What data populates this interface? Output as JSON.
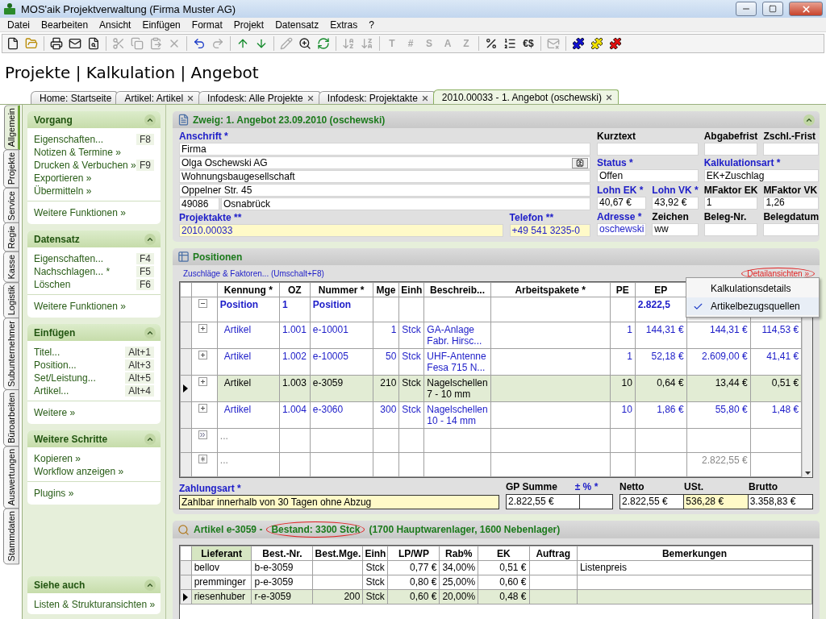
{
  "window": {
    "title": "MOS'aik Projektverwaltung (Firma Muster AG)"
  },
  "menu": [
    "Datei",
    "Bearbeiten",
    "Ansicht",
    "Einfügen",
    "Format",
    "Projekt",
    "Datensatz",
    "Extras",
    "?"
  ],
  "toolbar": [
    {
      "kind": "icon",
      "disabled": false
    },
    {
      "kind": "icon",
      "disabled": false
    },
    {
      "kind": "separator"
    },
    {
      "kind": "icon",
      "disabled": false
    },
    {
      "kind": "icon",
      "disabled": false
    },
    {
      "kind": "icon",
      "disabled": false
    },
    {
      "kind": "separator"
    },
    {
      "kind": "icon",
      "disabled": true
    },
    {
      "kind": "icon",
      "disabled": true
    },
    {
      "kind": "icon",
      "disabled": true
    },
    {
      "kind": "icon",
      "disabled": true
    },
    {
      "kind": "separator"
    },
    {
      "kind": "icon",
      "disabled": false
    },
    {
      "kind": "icon",
      "disabled": true
    },
    {
      "kind": "separator"
    },
    {
      "kind": "icon",
      "disabled": false
    },
    {
      "kind": "icon",
      "disabled": false
    },
    {
      "kind": "separator"
    },
    {
      "kind": "icon",
      "disabled": true
    },
    {
      "kind": "icon",
      "disabled": false
    },
    {
      "kind": "icon",
      "disabled": false
    },
    {
      "kind": "separator"
    },
    {
      "kind": "icon",
      "disabled": true
    },
    {
      "kind": "icon",
      "disabled": true
    },
    {
      "kind": "separator"
    },
    {
      "kind": "glyph",
      "text": "T",
      "disabled": true
    },
    {
      "kind": "glyph",
      "text": "#",
      "disabled": true
    },
    {
      "kind": "glyph",
      "text": "S",
      "disabled": true
    },
    {
      "kind": "glyph",
      "text": "A",
      "disabled": true
    },
    {
      "kind": "glyph",
      "text": "Z",
      "disabled": true
    },
    {
      "kind": "separator"
    },
    {
      "kind": "icon",
      "disabled": false
    },
    {
      "kind": "icon",
      "disabled": false
    },
    {
      "kind": "glyph",
      "text": "€$",
      "disabled": false
    },
    {
      "kind": "separator"
    },
    {
      "kind": "icon",
      "disabled": true
    },
    {
      "kind": "separator"
    },
    {
      "kind": "icon",
      "disabled": false
    },
    {
      "kind": "icon",
      "disabled": false
    },
    {
      "kind": "icon",
      "disabled": false
    }
  ],
  "heading": "Projekte | Kalkulation | Angebot",
  "tabs": [
    {
      "label": "Home: Startseite",
      "selected": false,
      "closable": false
    },
    {
      "label": "Artikel: Artikel",
      "selected": false,
      "closable": true
    },
    {
      "label": "Infodesk: Alle Projekte",
      "selected": false,
      "closable": true
    },
    {
      "label": "Infodesk: Projektakte",
      "selected": false,
      "closable": true
    },
    {
      "label": "2010.00033 - 1. Angebot (oschewski)",
      "selected": true,
      "closable": true
    }
  ],
  "side_tabs": [
    {
      "label": "Allgemein",
      "selected": true
    },
    {
      "label": "Projekte",
      "selected": false
    },
    {
      "label": "Service",
      "selected": false
    },
    {
      "label": "Regie",
      "selected": false
    },
    {
      "label": "Kasse",
      "selected": false
    },
    {
      "label": "Logistik",
      "selected": false
    },
    {
      "label": "Subunternehmer",
      "selected": false
    },
    {
      "label": "Büroarbeiten",
      "selected": false
    },
    {
      "label": "Auswertungen",
      "selected": false
    },
    {
      "label": "Stammdaten",
      "selected": false
    }
  ],
  "sidebar": {
    "panels": [
      {
        "title": "Vorgang",
        "items": [
          {
            "label": "Eigenschaften...",
            "shortcut": "F8"
          },
          {
            "label": "Notizen & Termine »"
          },
          {
            "label": "Drucken & Verbuchen »",
            "shortcut": "F9"
          },
          {
            "label": "Exportieren »"
          },
          {
            "label": "Übermitteln »"
          }
        ],
        "more": [
          "Weitere Funktionen »"
        ]
      },
      {
        "title": "Datensatz",
        "items": [
          {
            "label": "Eigenschaften...",
            "shortcut": "F4"
          },
          {
            "label": "Nachschlagen... *",
            "shortcut": "F5"
          },
          {
            "label": "Löschen",
            "shortcut": "F6"
          }
        ],
        "more": [
          "Weitere Funktionen »"
        ]
      },
      {
        "title": "Einfügen",
        "items": [
          {
            "label": "Titel...",
            "shortcut": "Alt+1"
          },
          {
            "label": "Position...",
            "shortcut": "Alt+3"
          },
          {
            "label": "Set/Leistung...",
            "shortcut": "Alt+5"
          },
          {
            "label": "Artikel...",
            "shortcut": "Alt+4"
          }
        ],
        "more": [
          "Weitere »"
        ]
      },
      {
        "title": "Weitere Schritte",
        "items": [
          {
            "label": "Kopieren »"
          },
          {
            "label": "Workflow anzeigen »"
          }
        ],
        "more": [
          "Plugins »"
        ]
      }
    ],
    "bottom_panel": {
      "title": "Siehe auch",
      "items": [
        {
          "label": "Listen & Strukturansichten »"
        }
      ]
    }
  },
  "branch": {
    "title": "Zweig: 1. Angebot 23.09.2010 (oschewski)",
    "address": {
      "label": "Anschrift *",
      "required": true,
      "lines": [
        {
          "value": "Firma",
          "button": false
        },
        {
          "value": "Olga Oschewski AG",
          "button": true
        },
        {
          "value": "Wohnungsbaugesellschaft",
          "button": false
        },
        {
          "value": "Oppelner Str. 45",
          "button": false
        }
      ],
      "zip": "49086",
      "city": "Osnabrück"
    },
    "bottom_fields": [
      {
        "label": "Projektakte **",
        "value": "2010.00033",
        "required": true,
        "highlight": true,
        "link": true
      },
      {
        "label": "Telefon **",
        "value": "+49 541 3235-0",
        "required": true,
        "highlight": true,
        "link": true
      }
    ],
    "fields": [
      {
        "label": "Kurztext",
        "required": false,
        "kind": "wide"
      },
      {
        "label": "Abgabefrist",
        "required": false,
        "kind": "narrow"
      },
      {
        "label": "Zschl.-Frist",
        "required": false,
        "kind": "narrow"
      },
      {
        "label": "Status *",
        "value": "Offen",
        "required": true,
        "kind": "wide",
        "link": false
      },
      {
        "label": "Kalkulationsart *",
        "value": "EK+Zuschlag",
        "required": true,
        "kind": "wide",
        "link": false
      },
      {
        "label": "Lohn EK *",
        "value": "40,67 €",
        "required": true,
        "kind": "narrow",
        "link": false
      },
      {
        "label": "Lohn VK *",
        "value": "43,92 €",
        "required": true,
        "kind": "narrow",
        "link": false
      },
      {
        "label": "MFaktor EK",
        "value": "1",
        "required": false,
        "kind": "narrow",
        "link": false
      },
      {
        "label": "MFaktor VK",
        "value": "1,26",
        "required": false,
        "kind": "narrow",
        "link": false
      },
      {
        "label": "Adresse *",
        "value": "oschewski",
        "required": true,
        "kind": "narrow",
        "link": true
      },
      {
        "label": "Zeichen",
        "value": "ww",
        "required": false,
        "kind": "narrow",
        "link": false
      },
      {
        "label": "Beleg-Nr.",
        "required": false,
        "kind": "narrow"
      },
      {
        "label": "Belegdatum",
        "required": false,
        "kind": "narrow"
      }
    ]
  },
  "positions": {
    "title": "Positionen",
    "surcharges_link": "Zuschläge & Faktoren... (Umschalt+F8)",
    "details_link": {
      "label": "Detailansichten »",
      "circled": true
    },
    "details_menu": [
      {
        "label": "Kalkulationsdetails",
        "checked": false
      },
      {
        "label": "Artikelbezugsquellen",
        "checked": true
      }
    ],
    "columns": [
      "Kennung *",
      "OZ",
      "Nummer *",
      "Mge",
      "Einh",
      "Beschreib...",
      "Arbeitspakete *",
      "PE",
      "EP"
    ],
    "rows": [
      {
        "kind": "title",
        "selected": false,
        "cells": [
          "Position",
          "1",
          "Position",
          null,
          null,
          null,
          null,
          null,
          "2.822,5",
          null,
          null
        ]
      },
      {
        "kind": "item",
        "selected": false,
        "cells": [
          "Artikel",
          "1.001",
          "e-10001",
          "1",
          "Stck",
          "GA-Anlage Fabr. Hirsc...",
          null,
          "1",
          "144,31 €",
          "144,31 €",
          "114,53 €"
        ]
      },
      {
        "kind": "item",
        "selected": false,
        "cells": [
          "Artikel",
          "1.002",
          "e-10005",
          "50",
          "Stck",
          "UHF-Antenne Fesa 715 N...",
          null,
          "1",
          "52,18 €",
          "2.609,00 €",
          "41,41 €"
        ]
      },
      {
        "kind": "item",
        "selected": true,
        "cells": [
          "Artikel",
          "1.003",
          "e-3059",
          "210",
          "Stck",
          "Nagelschellen 7 - 10 mm",
          null,
          "10",
          "0,64 €",
          "13,44 €",
          "0,51 €"
        ]
      },
      {
        "kind": "item",
        "selected": false,
        "cells": [
          "Artikel",
          "1.004",
          "e-3060",
          "300",
          "Stck",
          "Nagelschellen 10 - 14 mm",
          null,
          "10",
          "1,86 €",
          "55,80 €",
          "1,48 €"
        ]
      },
      {
        "kind": "new",
        "selected": false,
        "cells": [
          "...",
          null,
          null,
          null,
          null,
          null,
          null,
          null,
          null,
          null,
          null
        ]
      },
      {
        "kind": "sum",
        "selected": false,
        "cells": [
          "...",
          null,
          null,
          null,
          null,
          null,
          null,
          null,
          null,
          "2.822,55 €",
          null
        ]
      }
    ],
    "payment": {
      "label": "Zahlungsart *",
      "value": "Zahlbar innerhalb von 30 Tagen ohne Abzug",
      "required": true,
      "highlight": true
    },
    "totals": [
      {
        "label": "GP Summe",
        "value": "2.822,55 €",
        "required": false,
        "highlight": false
      },
      {
        "label": "± % *",
        "required": true,
        "highlight": false
      },
      {
        "label": "Netto",
        "value": "2.822,55 €",
        "required": false,
        "highlight": false
      },
      {
        "label": "USt.",
        "value": "536,28 €",
        "required": false,
        "highlight": true
      },
      {
        "label": "Brutto",
        "value": "3.358,83 €",
        "required": false,
        "highlight": false
      }
    ]
  },
  "article": {
    "title_parts": [
      {
        "text": "Artikel e-3059 -",
        "circled": false
      },
      {
        "text": "Bestand: 3300 Stck",
        "circled": true
      },
      {
        "text": "(1700 Hauptwarenlager, 1600 Nebenlager)",
        "circled": false
      }
    ],
    "columns": [
      {
        "label": "Lieferant",
        "sorted": true
      },
      {
        "label": "Best.-Nr.",
        "sorted": false
      },
      {
        "label": "Best.Mge.",
        "sorted": false
      },
      {
        "label": "Einh",
        "sorted": false
      },
      {
        "label": "LP/WP",
        "sorted": false
      },
      {
        "label": "Rab%",
        "sorted": false
      },
      {
        "label": "EK",
        "sorted": false
      },
      {
        "label": "Auftrag",
        "sorted": false
      },
      {
        "label": "Bemerkungen",
        "sorted": false
      }
    ],
    "rows": [
      {
        "selected": false,
        "cells": [
          "bellov",
          "b-e-3059",
          null,
          "Stck",
          "0,77 €",
          "34,00%",
          "0,51 €",
          null,
          "Listenpreis"
        ]
      },
      {
        "selected": false,
        "cells": [
          "premminger",
          "p-e-3059",
          null,
          "Stck",
          "0,80 €",
          "25,00%",
          "0,60 €",
          null,
          null
        ]
      },
      {
        "selected": true,
        "cells": [
          "riesenhuber",
          "r-e-3059",
          "200",
          "Stck",
          "0,60 €",
          "20,00%",
          "0,48 €",
          null,
          null
        ]
      }
    ]
  }
}
